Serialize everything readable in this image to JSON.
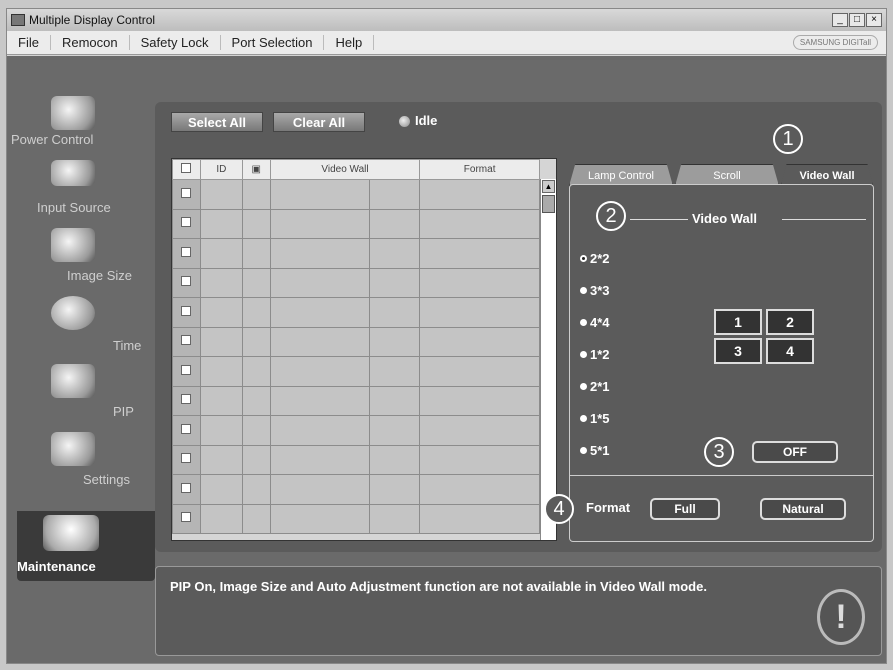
{
  "window": {
    "title": "Multiple Display Control"
  },
  "menu": [
    "File",
    "Remocon",
    "Safety Lock",
    "Port Selection",
    "Help"
  ],
  "brand": "SAMSUNG DIGITall",
  "sidebar": {
    "items": [
      {
        "label": "Power Control",
        "icon": "power-icon"
      },
      {
        "label": "Input Source",
        "icon": "input-source-icon"
      },
      {
        "label": "Image Size",
        "icon": "image-size-icon"
      },
      {
        "label": "Time",
        "icon": "clock-icon"
      },
      {
        "label": "PIP",
        "icon": "pip-icon"
      },
      {
        "label": "Settings",
        "icon": "settings-icon"
      }
    ],
    "active": {
      "label": "Maintenance",
      "icon": "maintenance-icon"
    }
  },
  "toolbar": {
    "select_all": "Select All",
    "clear_all": "Clear All",
    "status": "Idle"
  },
  "grid": {
    "headers": [
      "ID",
      "Video Wall",
      "Format"
    ],
    "row_count": 12
  },
  "tabs": [
    "Lamp Control",
    "Scroll",
    "Video Wall"
  ],
  "video_wall": {
    "title": "Video Wall",
    "options": [
      "2*2",
      "3*3",
      "4*4",
      "1*2",
      "2*1",
      "1*5",
      "5*1"
    ],
    "selected": "2*2",
    "cells": [
      "1",
      "2",
      "3",
      "4"
    ],
    "toggle": "OFF",
    "format_label": "Format",
    "format_full": "Full",
    "format_natural": "Natural"
  },
  "callouts": [
    "1",
    "2",
    "3",
    "4"
  ],
  "message": "PIP On, Image Size and Auto Adjustment function are not available in Video Wall mode.",
  "warning_glyph": "!"
}
